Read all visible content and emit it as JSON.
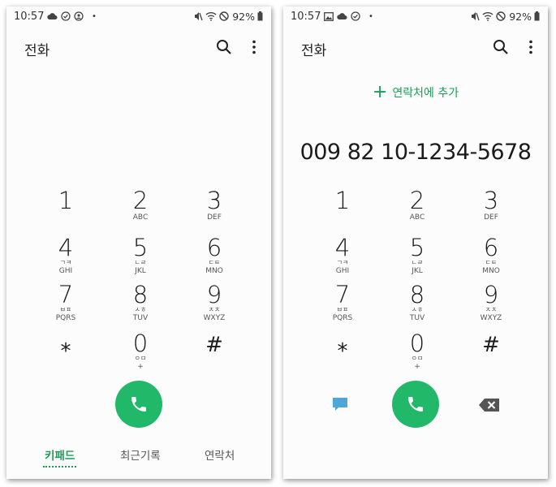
{
  "status_bar": {
    "time": "10:57",
    "battery": "92%"
  },
  "colors": {
    "accent": "#1a9e57",
    "call_button": "#21b86a",
    "message_icon": "#4ea6d9"
  },
  "app_title": "전화",
  "icons": [
    "search-icon",
    "more-vert-icon",
    "phone-icon",
    "message-icon",
    "backspace-icon"
  ],
  "keypad": [
    {
      "digit": "1",
      "kor": "",
      "letters": ""
    },
    {
      "digit": "2",
      "kor": "",
      "letters": "ABC"
    },
    {
      "digit": "3",
      "kor": "",
      "letters": "DEF"
    },
    {
      "digit": "4",
      "kor": "ㄱㅋ",
      "letters": "GHI"
    },
    {
      "digit": "5",
      "kor": "ㄴㄹ",
      "letters": "JKL"
    },
    {
      "digit": "6",
      "kor": "ㄷㅌ",
      "letters": "MNO"
    },
    {
      "digit": "7",
      "kor": "ㅂㅍ",
      "letters": "PQRS"
    },
    {
      "digit": "8",
      "kor": "ㅅㅎ",
      "letters": "TUV"
    },
    {
      "digit": "9",
      "kor": "ㅈㅊ",
      "letters": "WXYZ"
    },
    {
      "digit": "⁎",
      "kor": "",
      "letters": ""
    },
    {
      "digit": "0",
      "kor": "ㅇㅁ",
      "letters": "+"
    },
    {
      "digit": "#",
      "kor": "",
      "letters": ""
    }
  ],
  "left_screen": {
    "tabs": [
      {
        "label": "키패드",
        "active": true
      },
      {
        "label": "최근기록",
        "active": false
      },
      {
        "label": "연락처",
        "active": false
      }
    ]
  },
  "right_screen": {
    "add_contact_label": "연락처에 추가",
    "dialed_number": "009 82 10-1234-5678"
  }
}
